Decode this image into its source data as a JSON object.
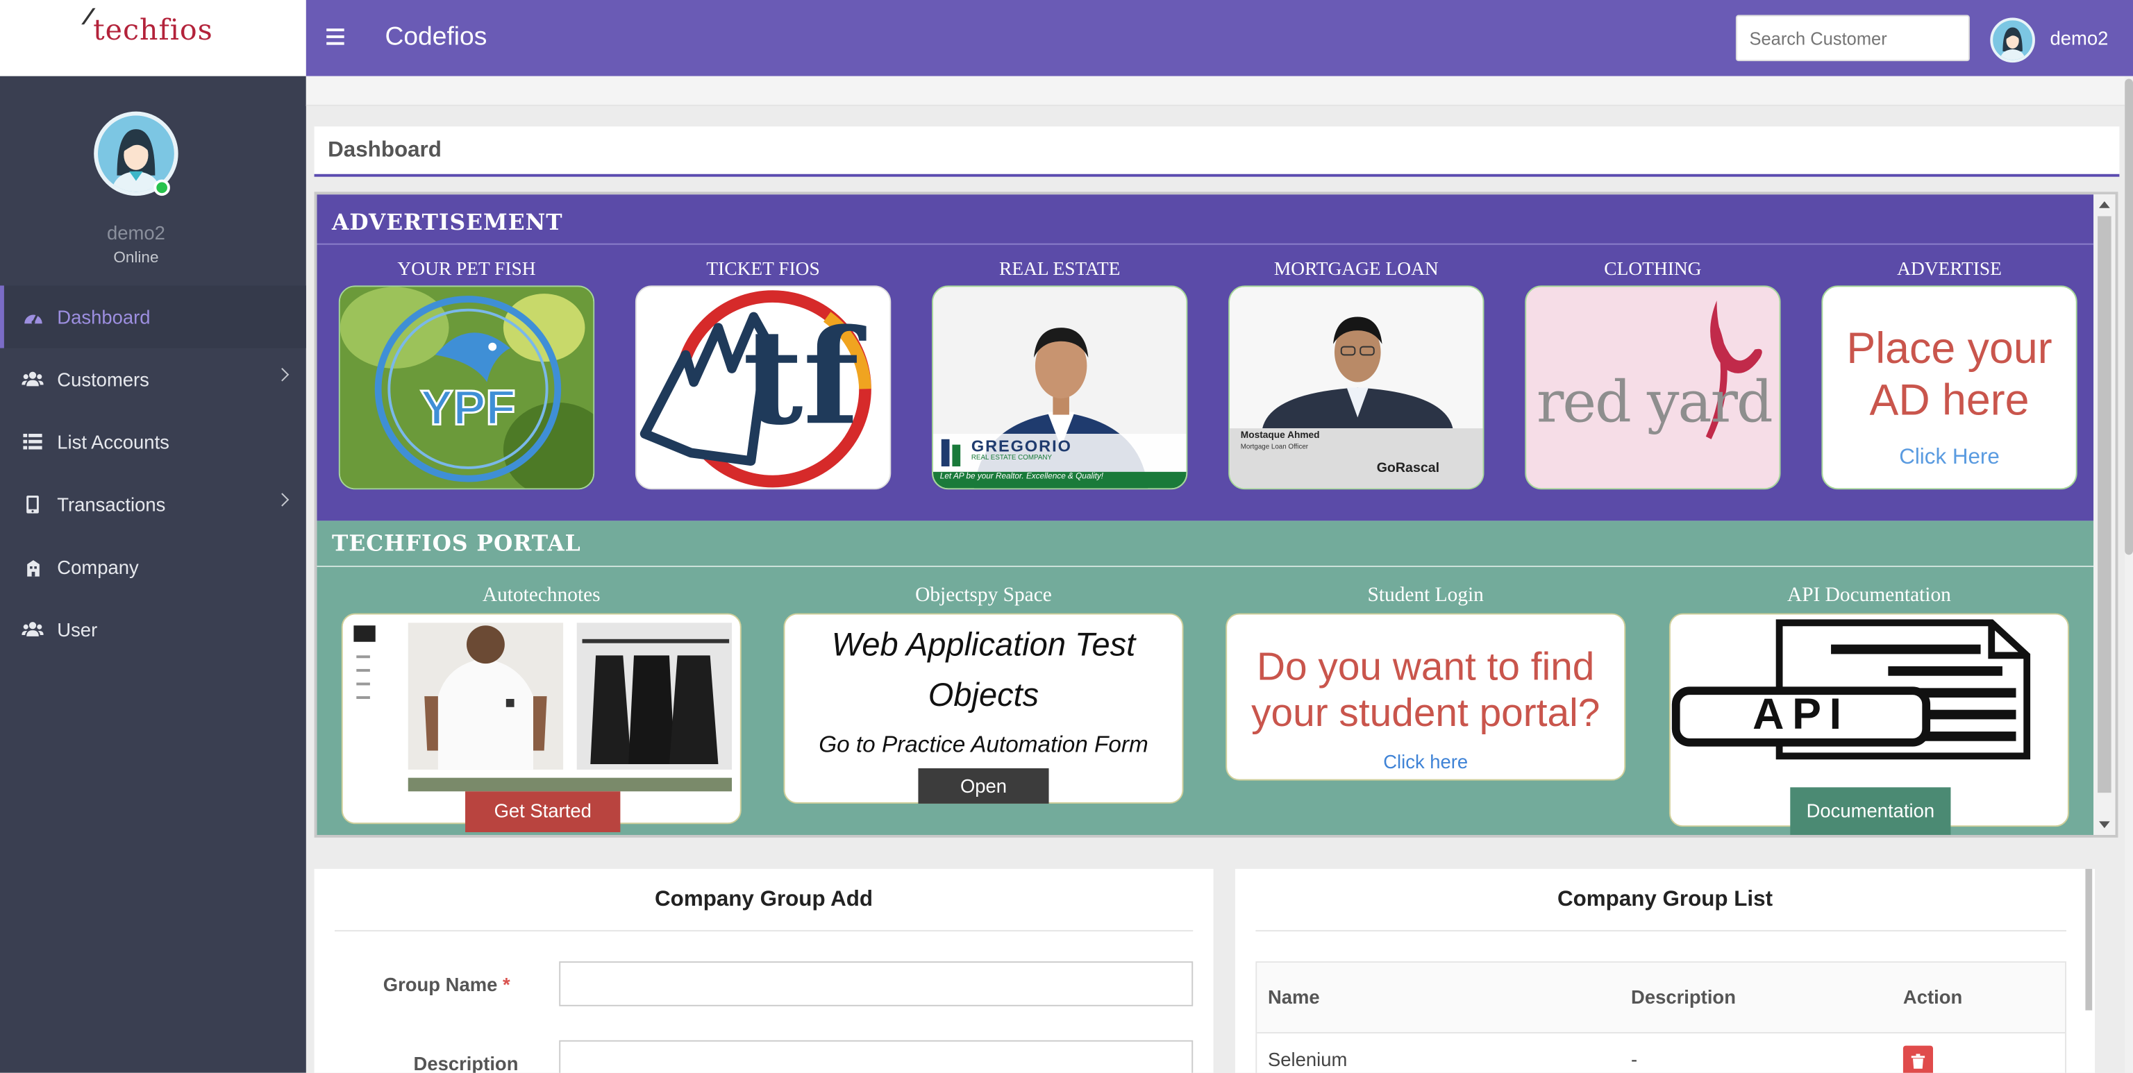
{
  "brand": {
    "logo_text": "techfios"
  },
  "topbar": {
    "app_title": "Codefios",
    "search_placeholder": "Search Customer",
    "username": "demo2"
  },
  "sidebar": {
    "username": "demo2",
    "status": "Online",
    "items": [
      {
        "label": "Dashboard",
        "icon": "dashboard-icon",
        "active": true
      },
      {
        "label": "Customers",
        "icon": "users-icon",
        "has_submenu": true
      },
      {
        "label": "List Accounts",
        "icon": "list-icon"
      },
      {
        "label": "Transactions",
        "icon": "tablet-icon",
        "has_submenu": true
      },
      {
        "label": "Company",
        "icon": "building-icon"
      },
      {
        "label": "User",
        "icon": "user-group-icon"
      }
    ]
  },
  "dashboard": {
    "title": "Dashboard"
  },
  "advertisement": {
    "title": "ADVERTISEMENT",
    "items": [
      {
        "label": "YOUR PET FISH",
        "logo_text": "YPF"
      },
      {
        "label": "TICKET FIOS",
        "logo_text": "tf"
      },
      {
        "label": "REAL ESTATE",
        "banner_name": "GREGORIO",
        "banner_sub": "REAL ESTATE COMPANY",
        "banner_tagline": "Let AP be your Realtor. Excellence & Quality!"
      },
      {
        "label": "MORTGAGE LOAN",
        "card_name": "Mostaque Ahmed",
        "card_role": "Mortgage Loan Officer",
        "card_brand": "GoRascal"
      },
      {
        "label": "CLOTHING",
        "logo_text": "red yard"
      },
      {
        "label": "ADVERTISE",
        "headline": "Place your AD here",
        "link": "Click Here"
      }
    ]
  },
  "portal": {
    "title": "TECHFIOS PORTAL",
    "items": [
      {
        "label": "Autotechnotes",
        "button": "Get Started"
      },
      {
        "label": "Objectspy Space",
        "headline": "Web Application Test Objects",
        "subline": "Go to Practice Automation Form",
        "button": "Open"
      },
      {
        "label": "Student Login",
        "headline": "Do you want to find your student portal?",
        "link": "Click here"
      },
      {
        "label": "API Documentation",
        "graphic_text": "API",
        "button": "Documentation"
      }
    ]
  },
  "group_add": {
    "title": "Company Group Add",
    "group_name_label": "Group Name",
    "description_label": "Description"
  },
  "group_list": {
    "title": "Company Group List",
    "columns": [
      "Name",
      "Description",
      "Action"
    ],
    "rows": [
      {
        "name": "Selenium",
        "description": "-"
      }
    ]
  },
  "colors": {
    "topbar": "#6a5bb5",
    "sidebar": "#3a3f51",
    "advertisement_bg": "#5b4ba8",
    "portal_bg": "#73ab9b",
    "accent": "#5b4bb0"
  }
}
